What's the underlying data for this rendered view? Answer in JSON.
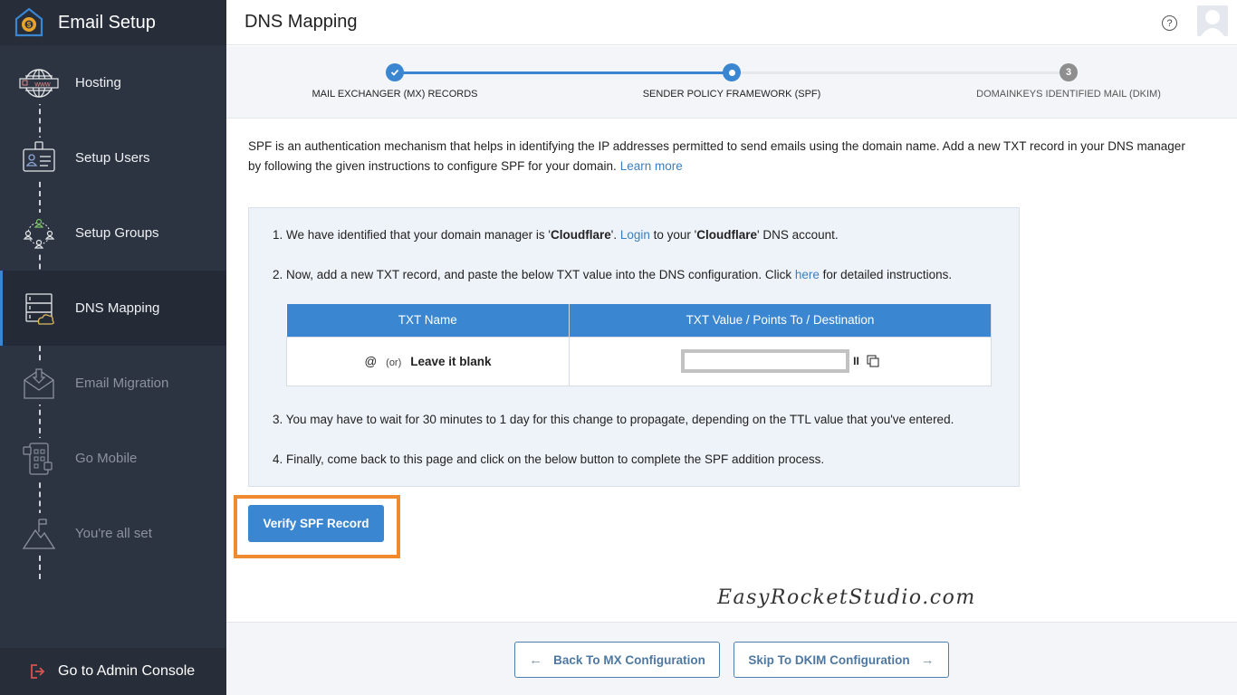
{
  "sidebar": {
    "title": "Email Setup",
    "items": [
      {
        "label": "Hosting",
        "icon": "globe-www-icon",
        "state": "done"
      },
      {
        "label": "Setup Users",
        "icon": "id-card-icon",
        "state": "done"
      },
      {
        "label": "Setup Groups",
        "icon": "group-network-icon",
        "state": "done"
      },
      {
        "label": "DNS Mapping",
        "icon": "server-cloud-icon",
        "state": "active"
      },
      {
        "label": "Email Migration",
        "icon": "envelope-download-icon",
        "state": "disabled"
      },
      {
        "label": "Go Mobile",
        "icon": "mobile-apps-icon",
        "state": "disabled"
      },
      {
        "label": "You're all set",
        "icon": "mountain-flag-icon",
        "state": "disabled"
      }
    ],
    "footer_label": "Go to Admin Console"
  },
  "header": {
    "title": "DNS Mapping",
    "help_icon": "?"
  },
  "stepper": {
    "steps": [
      {
        "label": "MAIL EXCHANGER (MX) RECORDS",
        "state": "done"
      },
      {
        "label": "SENDER POLICY FRAMEWORK (SPF)",
        "state": "current"
      },
      {
        "label": "DOMAINKEYS IDENTIFIED MAIL (DKIM)",
        "state": "todo",
        "number": "3"
      }
    ]
  },
  "intro": {
    "text": "SPF is an authentication mechanism that helps in identifying the IP addresses permitted to send emails using the domain name. Add a new TXT record in your DNS manager by following the given instructions to configure SPF for your domain.",
    "learn_more": "Learn more"
  },
  "instructions": {
    "step1_prefix": "1. We have identified that your domain manager is '",
    "provider": "Cloudflare",
    "step1_mid": "'. ",
    "login_link": "Login",
    "step1_mid2": " to your '",
    "step1_suffix": "' DNS account.",
    "step2_prefix": "2. Now, add a new TXT record, and paste the below TXT value into the DNS configuration. Click ",
    "here_link": "here",
    "step2_suffix": " for detailed instructions.",
    "step3": "3. You may have to wait for 30 minutes to 1 day for this change to propagate, depending on the TTL value that you've entered.",
    "step4": "4. Finally, come back to this page and click on the below button to complete the SPF addition process."
  },
  "txt_table": {
    "headers": [
      "TXT Name",
      "TXT Value / Points To / Destination"
    ],
    "row": {
      "name_at": "@",
      "name_or": "(or)",
      "name_blank": "Leave it blank",
      "value": "",
      "value_suffix": "II"
    }
  },
  "verify_button": "Verify SPF Record",
  "watermark": "EasyRocketStudio.com",
  "footer": {
    "back_label": "Back To MX Configuration",
    "back_arrow": "←",
    "skip_label": "Skip To DKIM Configuration",
    "skip_arrow": "→"
  },
  "colors": {
    "accent": "#3a86d1",
    "sidebar_bg": "#2d3441",
    "highlight": "#f08a2e",
    "link": "#3b7fc0"
  }
}
